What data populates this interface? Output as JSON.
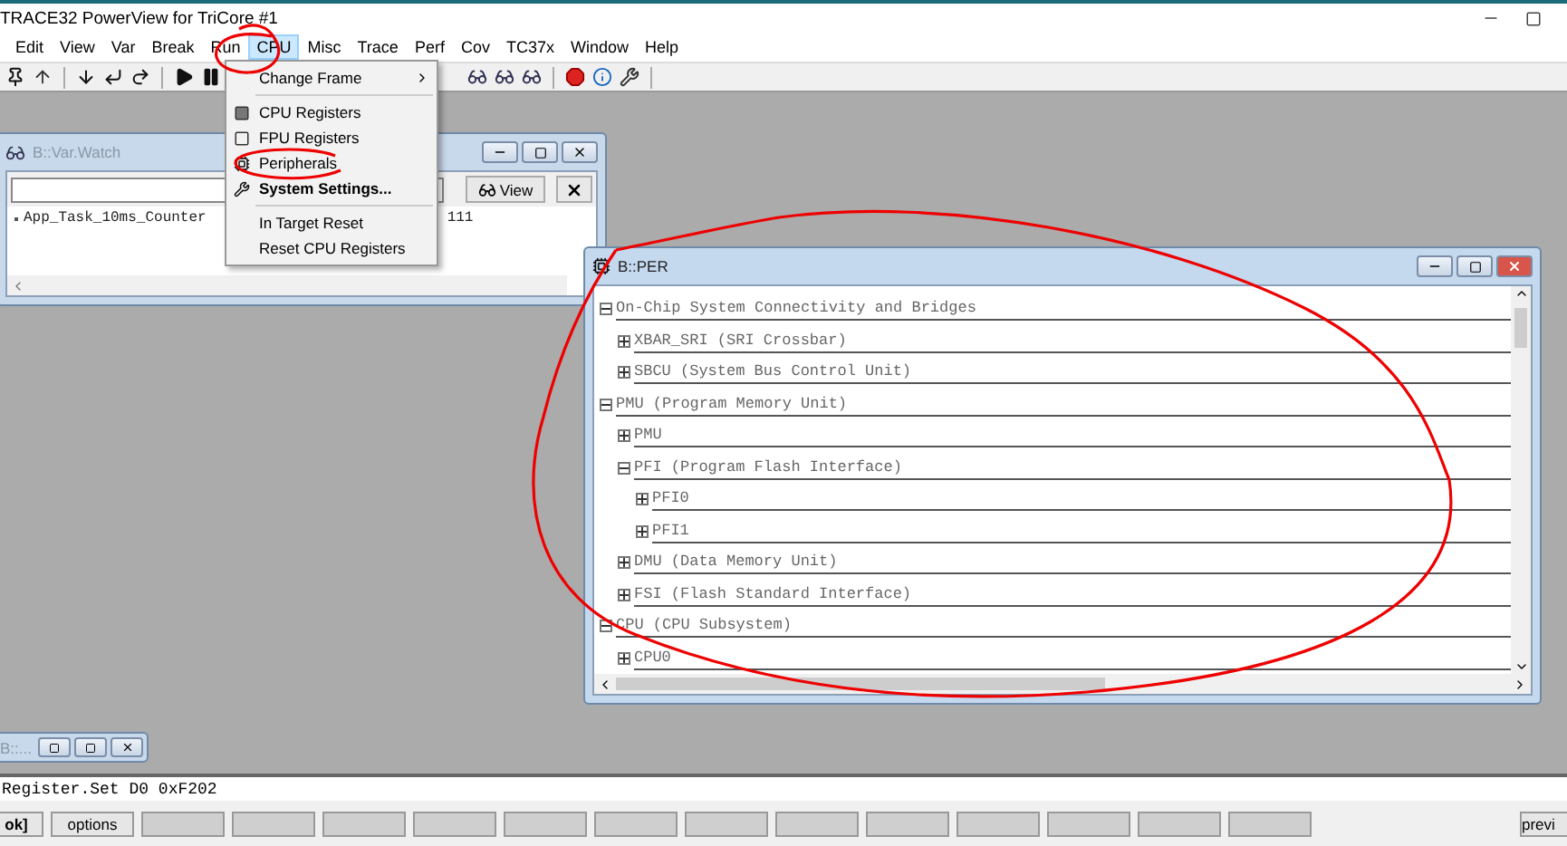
{
  "window": {
    "title": "TRACE32 PowerView for TriCore #1"
  },
  "menu": [
    {
      "label": "Edit",
      "selected": false
    },
    {
      "label": "View",
      "selected": false
    },
    {
      "label": "Var",
      "selected": false
    },
    {
      "label": "Break",
      "selected": false
    },
    {
      "label": "Run",
      "selected": false
    },
    {
      "label": "CPU",
      "selected": true
    },
    {
      "label": "Misc",
      "selected": false
    },
    {
      "label": "Trace",
      "selected": false
    },
    {
      "label": "Perf",
      "selected": false
    },
    {
      "label": "Cov",
      "selected": false
    },
    {
      "label": "TC37x",
      "selected": false
    },
    {
      "label": "Window",
      "selected": false
    },
    {
      "label": "Help",
      "selected": false
    }
  ],
  "dropdown": [
    {
      "kind": "submenu",
      "label": "Change Frame"
    },
    {
      "kind": "separator"
    },
    {
      "kind": "item",
      "label": "CPU Registers"
    },
    {
      "kind": "item",
      "label": "FPU Registers"
    },
    {
      "kind": "item",
      "label": "Peripherals"
    },
    {
      "kind": "default",
      "label": "System Settings..."
    },
    {
      "kind": "separator"
    },
    {
      "kind": "item",
      "label": "In Target Reset"
    },
    {
      "kind": "item",
      "label": "Reset CPU Registers"
    }
  ],
  "watch": {
    "title": "B::Var.Watch",
    "view_button": "View",
    "rows": [
      {
        "name": "App_Task_10ms_Counter",
        "value": "111"
      }
    ]
  },
  "per": {
    "title": "B::PER",
    "tree": [
      {
        "label": "On-Chip System Connectivity and Bridges",
        "expanded": true,
        "children": [
          {
            "label": "XBAR_SRI (SRI Crossbar)",
            "expanded": false
          },
          {
            "label": "SBCU (System Bus Control Unit)",
            "expanded": false
          }
        ]
      },
      {
        "label": "PMU (Program Memory Unit)",
        "expanded": true,
        "children": [
          {
            "label": "PMU",
            "expanded": false
          },
          {
            "label": "PFI (Program Flash Interface)",
            "expanded": true,
            "children": [
              {
                "label": "PFI0",
                "expanded": false
              },
              {
                "label": "PFI1",
                "expanded": false
              }
            ]
          },
          {
            "label": "DMU (Data Memory Unit)",
            "expanded": false
          },
          {
            "label": "FSI (Flash Standard Interface)",
            "expanded": false
          }
        ]
      },
      {
        "label": "CPU (CPU Subsystem)",
        "expanded": true,
        "children": [
          {
            "label": "CPU0",
            "expanded": false
          }
        ]
      }
    ]
  },
  "minimized": {
    "title": "B::..."
  },
  "command_line": {
    "value": "Register.Set D0 0xF202"
  },
  "softkeys": [
    "ok]",
    "options",
    "previ"
  ]
}
